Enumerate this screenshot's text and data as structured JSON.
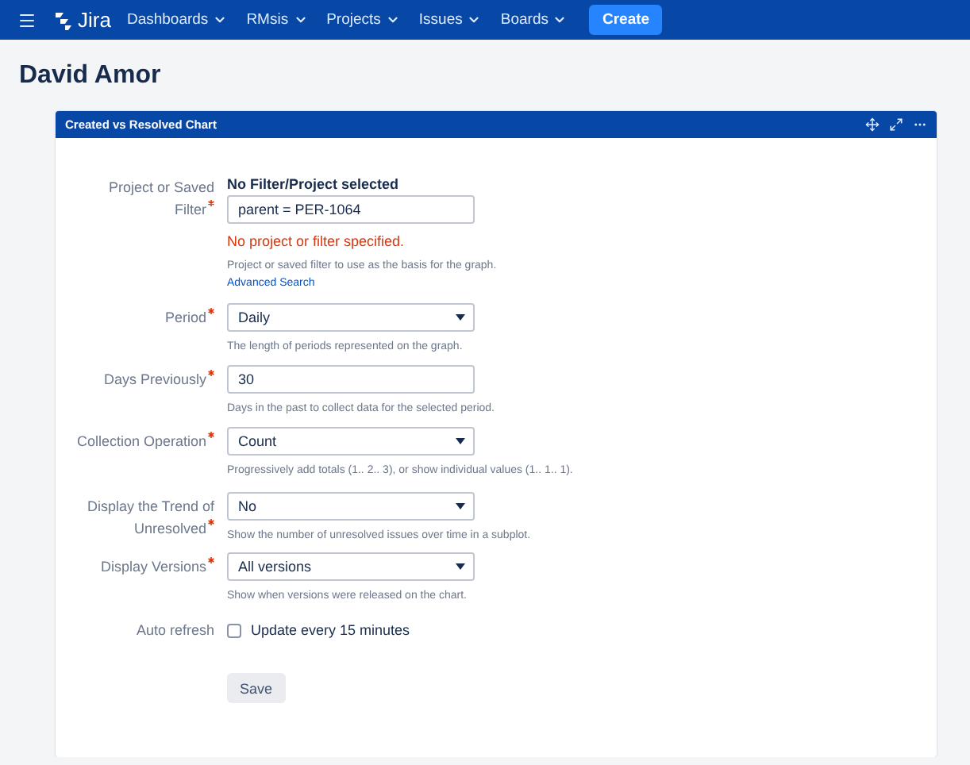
{
  "nav": {
    "product": "Jira",
    "menus": [
      {
        "label": "Dashboards"
      },
      {
        "label": "RMsis"
      },
      {
        "label": "Projects"
      },
      {
        "label": "Issues"
      },
      {
        "label": "Boards"
      }
    ],
    "create": "Create"
  },
  "page_title": "David Amor",
  "gadget": {
    "title": "Created vs Resolved Chart",
    "fields": [
      {
        "kind": "text",
        "label": "Project or Saved Filter",
        "required": true,
        "heading": "No Filter/Project selected",
        "value": "parent = PER-1064",
        "error": "No project or filter specified.",
        "description": "Project or saved filter to use as the basis for the graph.",
        "link": "Advanced Search"
      },
      {
        "kind": "select",
        "label": "Period",
        "required": true,
        "value": "Daily",
        "description": "The length of periods represented on the graph."
      },
      {
        "kind": "text",
        "label": "Days Previously",
        "required": true,
        "value": "30",
        "description": "Days in the past to collect data for the selected period."
      },
      {
        "kind": "select",
        "label": "Collection Operation",
        "required": true,
        "value": "Count",
        "description": "Progressively add totals (1.. 2.. 3), or show individual values (1.. 1.. 1)."
      },
      {
        "kind": "select",
        "label": "Display the Trend of Unresolved",
        "required": true,
        "value": "No",
        "description": "Show the number of unresolved issues over time in a subplot."
      },
      {
        "kind": "select",
        "label": "Display Versions",
        "required": true,
        "value": "All versions",
        "description": "Show when versions were released on the chart."
      },
      {
        "kind": "checkbox",
        "label": "Auto refresh",
        "required": false,
        "value": "Update every 15 minutes",
        "checked": false
      }
    ],
    "save": "Save"
  }
}
